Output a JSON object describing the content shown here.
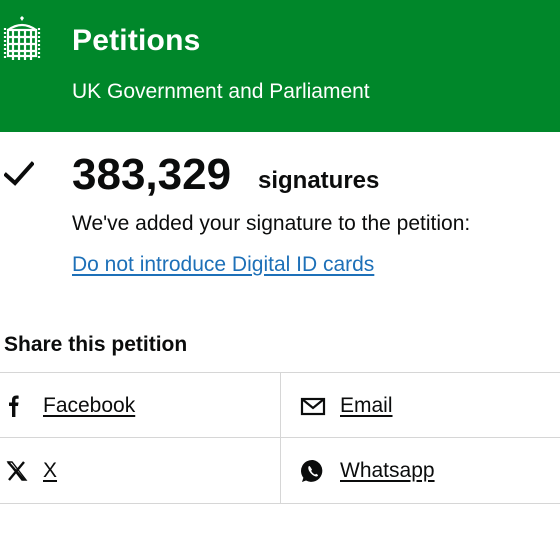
{
  "header": {
    "brand_color": "#00872a",
    "logo_icon": "portcullis-icon",
    "title": "Petitions",
    "subtitle": "UK Government and Parliament"
  },
  "confirmation": {
    "check_icon": "checkmark-icon",
    "count": "383,329",
    "count_label": "signatures",
    "message": "We've added your signature to the petition:",
    "petition_link": "Do not introduce Digital ID cards",
    "link_color": "#1d70b8"
  },
  "share": {
    "title": "Share this petition",
    "items": [
      {
        "label": "Facebook",
        "icon": "facebook-icon"
      },
      {
        "label": "Email",
        "icon": "email-icon"
      },
      {
        "label": "X",
        "icon": "x-icon"
      },
      {
        "label": "Whatsapp",
        "icon": "whatsapp-icon"
      }
    ]
  }
}
